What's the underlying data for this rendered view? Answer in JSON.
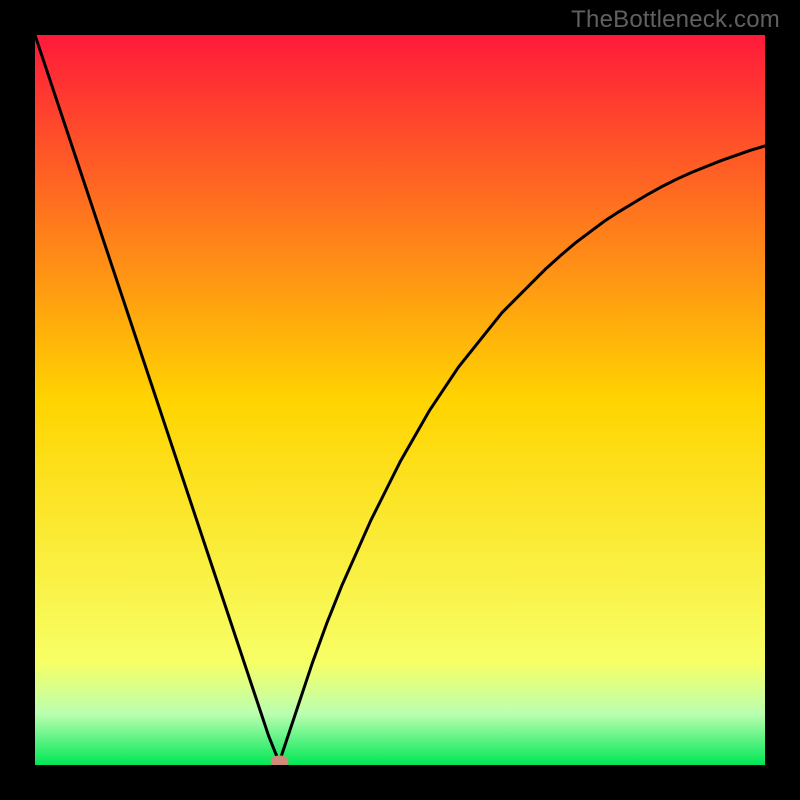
{
  "watermark": {
    "text": "TheBottleneck.com"
  },
  "colors": {
    "frame": "#000000",
    "curve": "#000000",
    "marker": "#d18a7a",
    "gradient_top": "#ff1a3a",
    "gradient_mid": "#ffd400",
    "gradient_low1": "#f7ff66",
    "gradient_low2": "#baffb0",
    "gradient_bottom": "#00e756"
  },
  "chart_data": {
    "type": "line",
    "title": "",
    "xlabel": "",
    "ylabel": "",
    "xlim": [
      0,
      100
    ],
    "ylim": [
      0,
      100
    ],
    "x": [
      0,
      2,
      4,
      6,
      8,
      10,
      12,
      14,
      16,
      18,
      20,
      22,
      24,
      26,
      28,
      30,
      31,
      32,
      33,
      33.5,
      34,
      36,
      38,
      40,
      42,
      44,
      46,
      48,
      50,
      52,
      54,
      56,
      58,
      60,
      62,
      64,
      66,
      68,
      70,
      72,
      74,
      76,
      78,
      80,
      82,
      84,
      86,
      88,
      90,
      92,
      94,
      96,
      98,
      100
    ],
    "values": [
      100,
      94,
      88,
      82,
      76,
      70,
      64,
      58,
      52,
      46,
      40,
      34,
      28,
      22,
      16,
      10,
      7,
      4,
      1.5,
      0.5,
      2,
      8,
      14,
      19.5,
      24.5,
      29,
      33.5,
      37.5,
      41.5,
      45,
      48.5,
      51.5,
      54.5,
      57,
      59.5,
      62,
      64,
      66,
      68,
      69.8,
      71.5,
      73,
      74.5,
      75.8,
      77,
      78.2,
      79.3,
      80.3,
      81.2,
      82,
      82.8,
      83.5,
      84.2,
      84.8
    ],
    "marker": {
      "x": 33.5,
      "y": 0.5
    },
    "background": {
      "type": "vertical-gradient",
      "stops": [
        {
          "offset": 0.0,
          "color": "#ff1a3a"
        },
        {
          "offset": 0.5,
          "color": "#ffd400"
        },
        {
          "offset": 0.86,
          "color": "#f7ff66"
        },
        {
          "offset": 0.93,
          "color": "#baffb0"
        },
        {
          "offset": 1.0,
          "color": "#00e756"
        }
      ]
    }
  }
}
